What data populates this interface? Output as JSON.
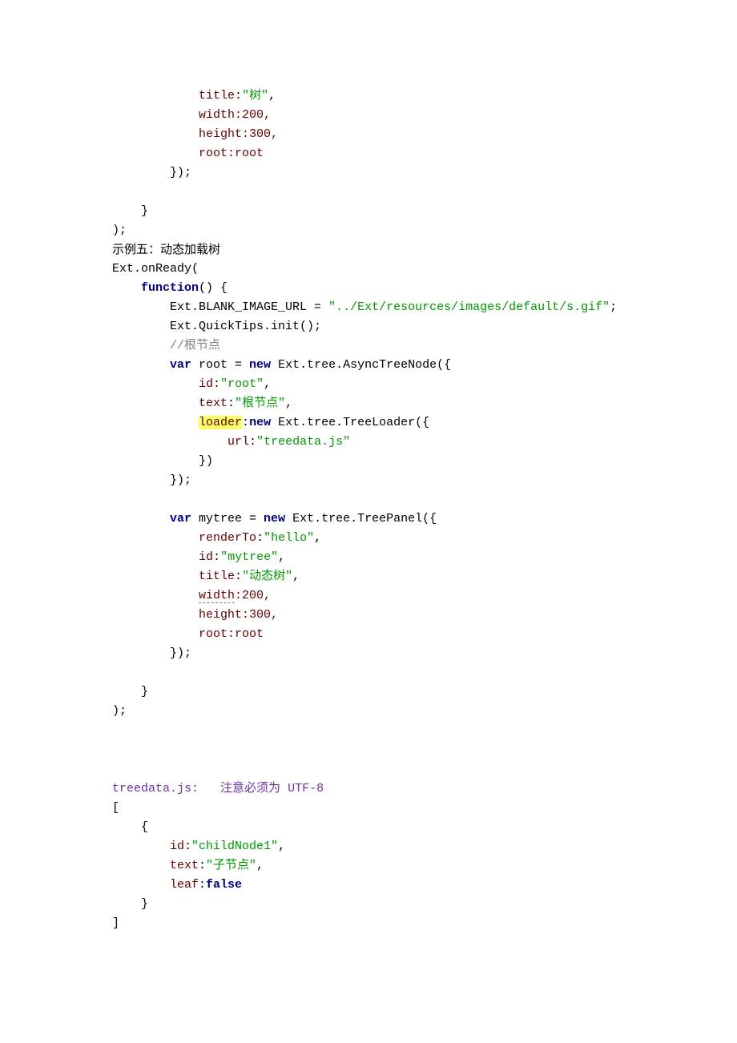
{
  "block1": {
    "titleKey": "title",
    "titleVal": "\"树\"",
    "widthLine": "width:200,",
    "heightLine": "height:300,",
    "rootLine": "root:root",
    "closePanel": "});",
    "closeFn": "}",
    "closeReady": ");"
  },
  "example5Label": "示例五：动态加载树",
  "onReady": "Ext.onReady(",
  "fnOpen": "() {",
  "functionKw": "function",
  "blankUrlLhs": "Ext.BLANK_IMAGE_URL = ",
  "blankUrlVal": "\"../Ext/resources/images/default/s.gif\"",
  "semicolon": ";",
  "quickTips": "Ext.QuickTips.init();",
  "rootComment": "//根节点",
  "varKw": "var",
  "newKw": "new",
  "rootDecl1": " root = ",
  "rootDecl2": " Ext.tree.AsyncTreeNode({",
  "idKey": "id",
  "rootIdVal": "\"root\"",
  "textKey": "text",
  "rootTextVal": "\"根节点\"",
  "loaderKey": "loader",
  "loaderNew": " Ext.tree.TreeLoader({",
  "urlKey": "url",
  "urlVal": "\"treedata.js\"",
  "closeLoader": "})",
  "closeRoot": "});",
  "mytreeDecl1": " mytree = ",
  "mytreeDecl2": " Ext.tree.TreePanel({",
  "renderToKey": "renderTo",
  "renderToVal": "\"hello\"",
  "mytreeIdVal": "\"mytree\"",
  "titleKey2": "title",
  "titleVal2": "\"动态树\"",
  "widthLine2": "width",
  "widthRest2": ":200,",
  "heightLine2": "height:300,",
  "rootLine2": "root:root",
  "closePanel2": "});",
  "closeFn2": "}",
  "closeReady2": ");",
  "treedataNote1": "treedata.js:",
  "treedataNote2": "注意必须为",
  "treedataNote3": "UTF-8",
  "arrOpen": "[",
  "objOpen": "{",
  "childIdVal": "\"childNode1\"",
  "childTextVal": "\"子节点\"",
  "leafKey": "leaf",
  "falseKw": "false",
  "objClose": "}",
  "arrClose": "]",
  "comma": ",",
  "colon": ":"
}
